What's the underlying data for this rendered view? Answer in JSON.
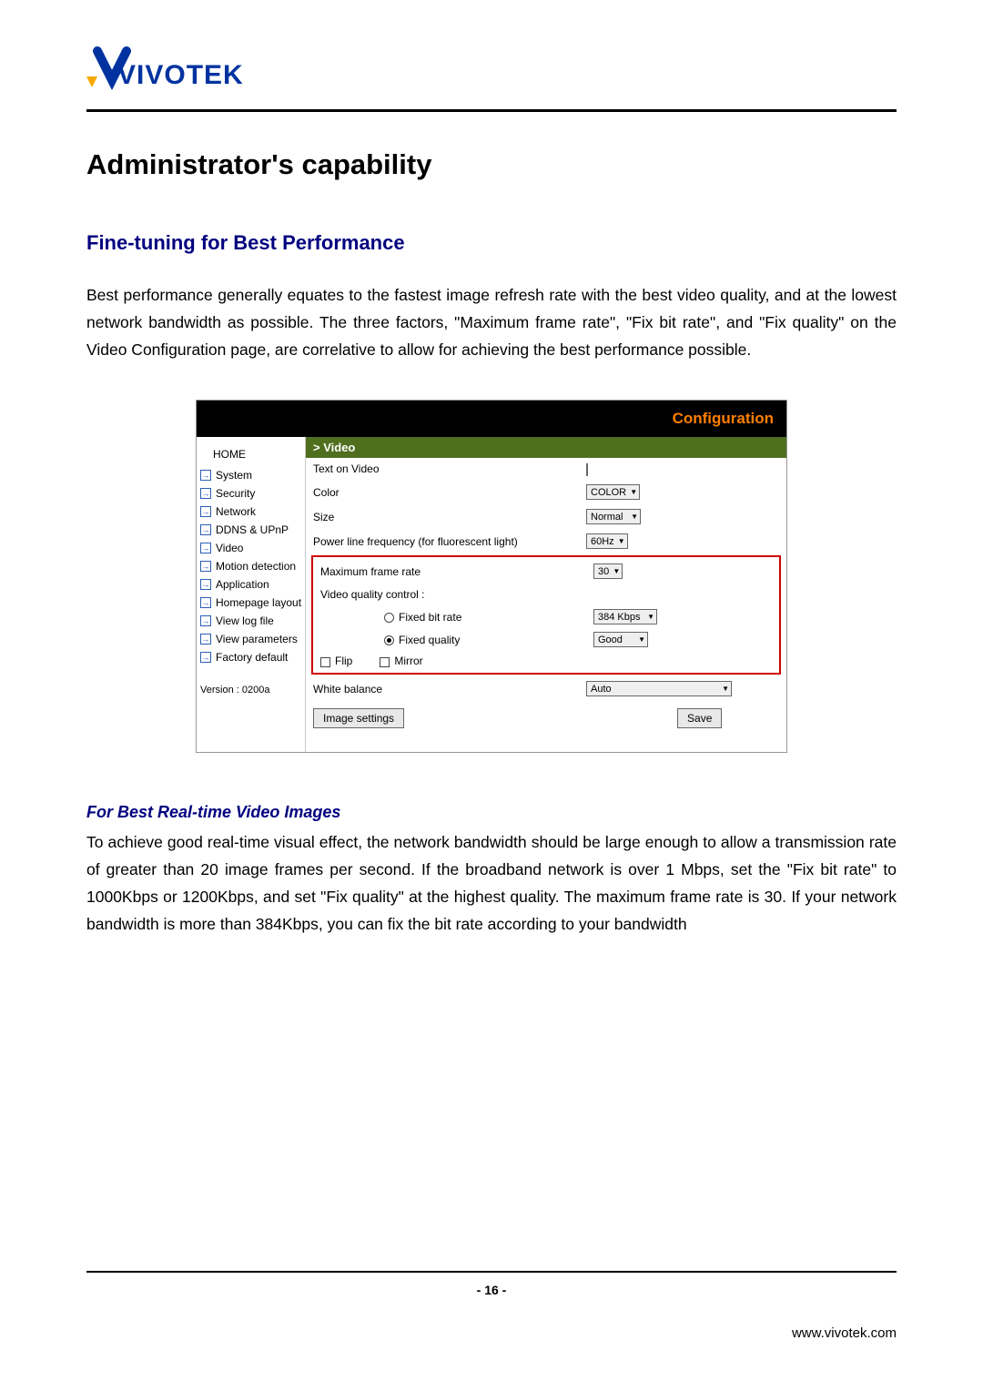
{
  "logo_text": "VIVOTEK",
  "heading": "Administrator's capability",
  "subheading": "Fine-tuning for Best Performance",
  "intro": "Best performance generally equates to the fastest image refresh rate with the best video quality, and at the lowest network bandwidth as possible. The three factors, \"Maximum frame rate\", \"Fix bit rate\", and \"Fix quality\" on the Video Configuration page, are correlative to allow for achieving the best performance possible.",
  "config": {
    "title": "Configuration",
    "sidebar": {
      "home": "HOME",
      "items": [
        "System",
        "Security",
        "Network",
        "DDNS & UPnP",
        "Video",
        "Motion detection",
        "Application",
        "Homepage layout",
        "View log file",
        "View parameters",
        "Factory default"
      ],
      "version": "Version : 0200a"
    },
    "form": {
      "section": "> Video",
      "rows": {
        "text_on_video": {
          "label": "Text on Video",
          "value": ""
        },
        "color": {
          "label": "Color",
          "value": "COLOR"
        },
        "size": {
          "label": "Size",
          "value": "Normal"
        },
        "powerline": {
          "label": "Power line frequency (for fluorescent light)",
          "value": "60Hz"
        },
        "max_frame": {
          "label": "Maximum frame rate",
          "value": "30"
        },
        "vqc": {
          "label": "Video quality control :"
        },
        "fixed_bit": {
          "label": "Fixed bit rate",
          "value": "384 Kbps"
        },
        "fixed_quality": {
          "label": "Fixed quality",
          "value": "Good"
        },
        "flip": "Flip",
        "mirror": "Mirror",
        "white_balance": {
          "label": "White balance",
          "value": "Auto"
        }
      },
      "buttons": {
        "image_settings": "Image settings",
        "save": "Save"
      }
    }
  },
  "subheading2": "For Best Real-time Video Images",
  "para2": "To achieve good real-time visual effect, the network bandwidth should be large enough to allow a transmission rate of greater than 20 image frames per second. If the broadband network is over 1 Mbps, set the \"Fix bit rate\" to 1000Kbps or 1200Kbps, and set \"Fix quality\" at the highest quality. The maximum frame rate is 30. If your network bandwidth is more than 384Kbps, you can fix the bit rate according to your bandwidth",
  "page_number": "- 16 -",
  "footer_url": "www.vivotek.com"
}
